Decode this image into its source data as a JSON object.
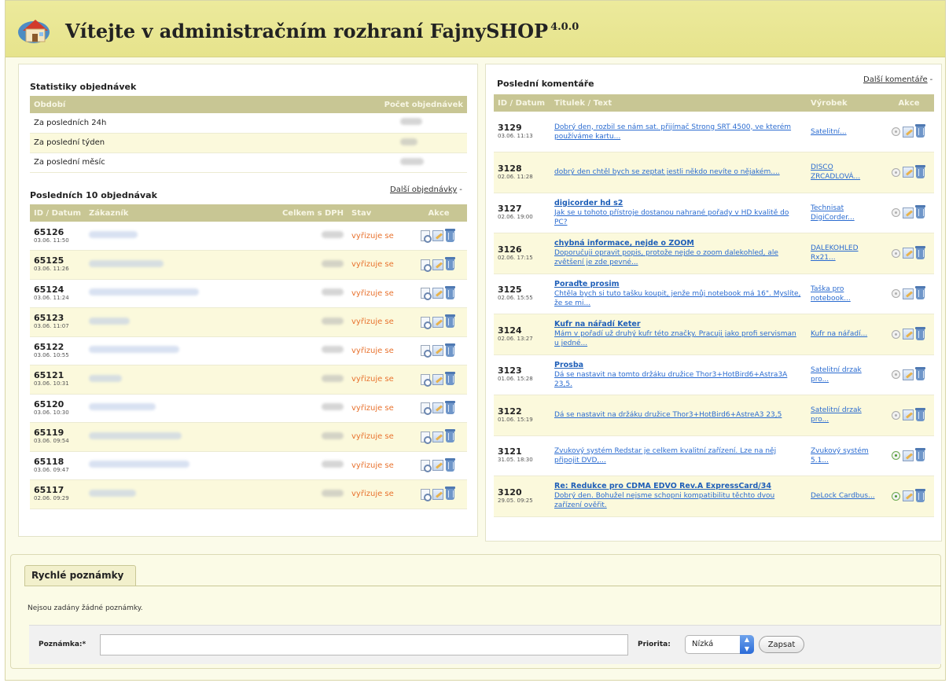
{
  "header": {
    "title": "Vítejte v administračním rozhraní FajnySHOP",
    "version": "4.0.0"
  },
  "stats": {
    "title": "Statistiky objednávek",
    "columns": [
      "Období",
      "Počet objednávek"
    ],
    "rows": [
      {
        "period": "Za posledních 24h"
      },
      {
        "period": "Za poslední týden"
      },
      {
        "period": "Za poslední měsíc"
      }
    ]
  },
  "orders": {
    "title": "Posledních 10 objednávak",
    "more_label": "Další objednávky",
    "columns": {
      "id_date": "ID / Datum",
      "customer": "Zákazník",
      "total": "Celkem s DPH",
      "status": "Stav",
      "actions": "Akce"
    },
    "rows": [
      {
        "id": "65126",
        "date": "03.06. 11:50",
        "status": "vyřizuje se"
      },
      {
        "id": "65125",
        "date": "03.06. 11:26",
        "status": "vyřizuje se"
      },
      {
        "id": "65124",
        "date": "03.06. 11:24",
        "status": "vyřizuje se"
      },
      {
        "id": "65123",
        "date": "03.06. 11:07",
        "status": "vyřizuje se"
      },
      {
        "id": "65122",
        "date": "03.06. 10:55",
        "status": "vyřizuje se"
      },
      {
        "id": "65121",
        "date": "03.06. 10:31",
        "status": "vyřizuje se"
      },
      {
        "id": "65120",
        "date": "03.06. 10:30",
        "status": "vyřizuje se"
      },
      {
        "id": "65119",
        "date": "03.06. 09:54",
        "status": "vyřizuje se"
      },
      {
        "id": "65118",
        "date": "03.06. 09:47",
        "status": "vyřizuje se"
      },
      {
        "id": "65117",
        "date": "02.06. 09:29",
        "status": "vyřizuje se"
      }
    ]
  },
  "comments": {
    "title": "Poslední komentáře",
    "more_label": "Další komentáře",
    "columns": {
      "id_date": "ID / Datum",
      "title_text": "Titulek / Text",
      "product": "Výrobek",
      "actions": "Akce"
    },
    "rows": [
      {
        "id": "3129",
        "date": "03.06. 11:13",
        "title": "",
        "text": "Dobrý den, rozbil se nám sat. přijímač Strong SRT 4500, ve kterém používáme kartu...",
        "product": "Satelitní...",
        "approved": false
      },
      {
        "id": "3128",
        "date": "02.06. 11:28",
        "title": "",
        "text": "dobrý den chtěl bych se zeptat jestli někdo nevíte o nějakém....",
        "product": "DISCO ZRCADLOVÁ...",
        "approved": false
      },
      {
        "id": "3127",
        "date": "02.06. 19:00",
        "title": "digicorder hd s2",
        "text": "Jak se u tohoto přístroje dostanou nahrané pořady v HD kvalitě do PC?",
        "product": "Technisat DigiCorder...",
        "approved": false
      },
      {
        "id": "3126",
        "date": "02.06. 17:15",
        "title": "chybná informace, nejde o ZOOM",
        "text": "Doporučuji opravit popis, protože nejde o zoom dalekohled, ale zvětšení je zde pevné...",
        "product": "DALEKOHLED Rx21...",
        "approved": false
      },
      {
        "id": "3125",
        "date": "02.06. 15:55",
        "title": "Poraďte prosim",
        "text": "Chtěla bych si tuto tašku koupit, jenže můj notebook má 16\". Myslíte, že se mi...",
        "product": "Taška pro notebook...",
        "approved": false
      },
      {
        "id": "3124",
        "date": "02.06. 13:27",
        "title": "Kufr na nářadí Keter",
        "text": "Mám v pořadí už druhý kufr této značky. Pracuji jako profi servisman u jedné...",
        "product": "Kufr na nářadí...",
        "approved": false
      },
      {
        "id": "3123",
        "date": "01.06. 15:28",
        "title": "Prosba",
        "text": "Dá se nastavit na tomto držáku družice Thor3+HotBird6+Astra3A 23,5.",
        "product": "Satelitní drzak pro...",
        "approved": false
      },
      {
        "id": "3122",
        "date": "01.06. 15:19",
        "title": "",
        "text": "Dá se nastavit na držáku družice Thor3+HotBird6+AstreA3 23,5",
        "product": "Satelitní drzak pro...",
        "approved": false
      },
      {
        "id": "3121",
        "date": "31.05. 18:30",
        "title": "",
        "text": "Zvukový systém Redstar je celkem kvalitní zařízení. Lze na něj připojit DVD,...",
        "product": "Zvukový systém 5.1...",
        "approved": true
      },
      {
        "id": "3120",
        "date": "29.05. 09:25",
        "title": "Re: Redukce pro CDMA EDVO Rev.A ExpressCard/34",
        "text": "Dobrý den. Bohužel nejsme schopni kompatibilitu těchto dvou zařízení ověřit.",
        "product": "DeLock Cardbus...",
        "approved": true
      }
    ]
  },
  "notes": {
    "title": "Rychlé poznámky",
    "empty": "Nejsou zadány žádné poznámky.",
    "note_label": "Poznámka:*",
    "note_value": "",
    "priority_label": "Priorita:",
    "priority_value": "Nízká",
    "submit_label": "Zapsat"
  },
  "colors": {
    "header_bg": "#e9e694",
    "table_header": "#c8c694",
    "row_alt": "#fbf9dc",
    "status_orange": "#e8722e",
    "link_blue": "#2a6bd0"
  },
  "icons": [
    "house-logo-icon",
    "view-icon",
    "edit-icon",
    "delete-icon",
    "approve-icon"
  ]
}
